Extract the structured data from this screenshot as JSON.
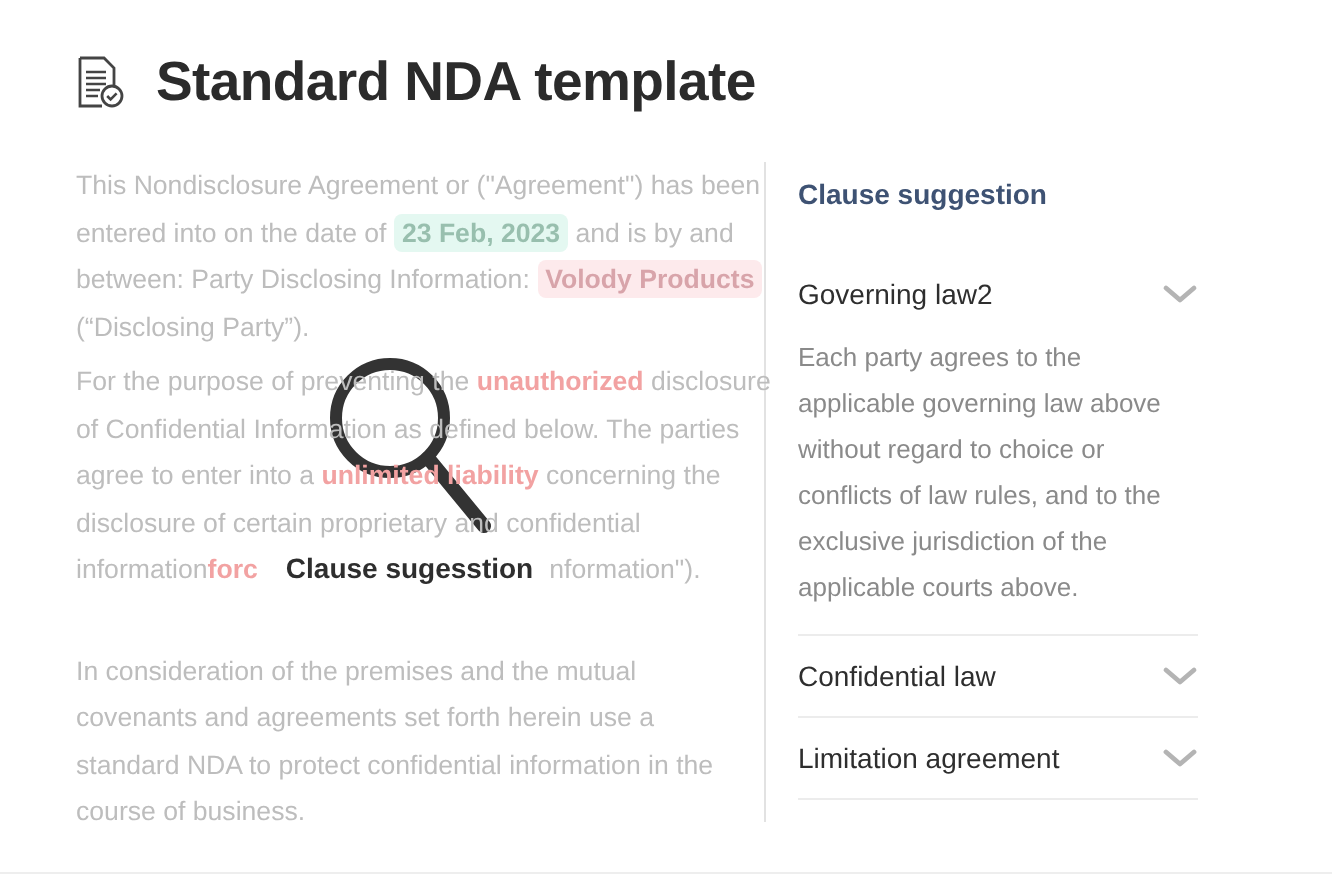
{
  "title": "Standard NDA template",
  "paragraphs": [
    {
      "lines": [
        [
          {
            "kind": "plain",
            "text": "This Nondisclosure Agreement or (\"Agreement\") has been"
          }
        ],
        [
          {
            "kind": "plain",
            "text": "entered into on the date of "
          },
          {
            "kind": "date",
            "text": "23 Feb, 2023"
          },
          {
            "kind": "plain",
            "text": " and is by and"
          }
        ],
        [
          {
            "kind": "plain",
            "text": "between: Party Disclosing Information: "
          },
          {
            "kind": "party",
            "text": "Volody Products"
          }
        ],
        [
          {
            "kind": "plain",
            "text": "(“Disclosing Party”)."
          }
        ]
      ]
    },
    {
      "lines": [
        [
          {
            "kind": "plain",
            "text": "For the purpose of preventing the "
          },
          {
            "kind": "risk",
            "text": "unauthorized"
          },
          {
            "kind": "plain",
            "text": " disclosure"
          }
        ],
        [
          {
            "kind": "plain",
            "text": "of Confidential Information as defined below. The parties"
          }
        ],
        [
          {
            "kind": "plain",
            "text": "agree to enter into a "
          },
          {
            "kind": "risk",
            "text": "unlimited liability"
          },
          {
            "kind": "plain",
            "text": " concerning the"
          }
        ],
        [
          {
            "kind": "plain",
            "text": "disclosure of certain proprietary and confidential"
          }
        ],
        [
          {
            "kind": "plain",
            "text": "information "
          },
          {
            "kind": "risk",
            "text": "forc"
          },
          {
            "kind": "label",
            "text": "Clause sugesstion"
          },
          {
            "kind": "plain",
            "text": "nformation\")."
          }
        ]
      ]
    },
    {
      "lines": [
        [
          {
            "kind": "plain",
            "text": "In consideration of the premises and the mutual"
          }
        ],
        [
          {
            "kind": "plain",
            "text": "covenants and agreements set forth herein use a"
          }
        ],
        [
          {
            "kind": "plain",
            "text": "standard NDA to protect confidential information in the"
          }
        ],
        [
          {
            "kind": "plain",
            "text": "course of business."
          }
        ]
      ]
    }
  ],
  "panel": {
    "heading": "Clause suggestion",
    "items": [
      {
        "title": "Governing law2",
        "expanded": true,
        "body": "Each party agrees to the applicable governing law above without regard to choice or conflicts of law rules, and to the exclusive jurisdiction of the applicable courts above."
      },
      {
        "title": "Confidential law"
      },
      {
        "title": "Limitation agreement"
      }
    ]
  }
}
